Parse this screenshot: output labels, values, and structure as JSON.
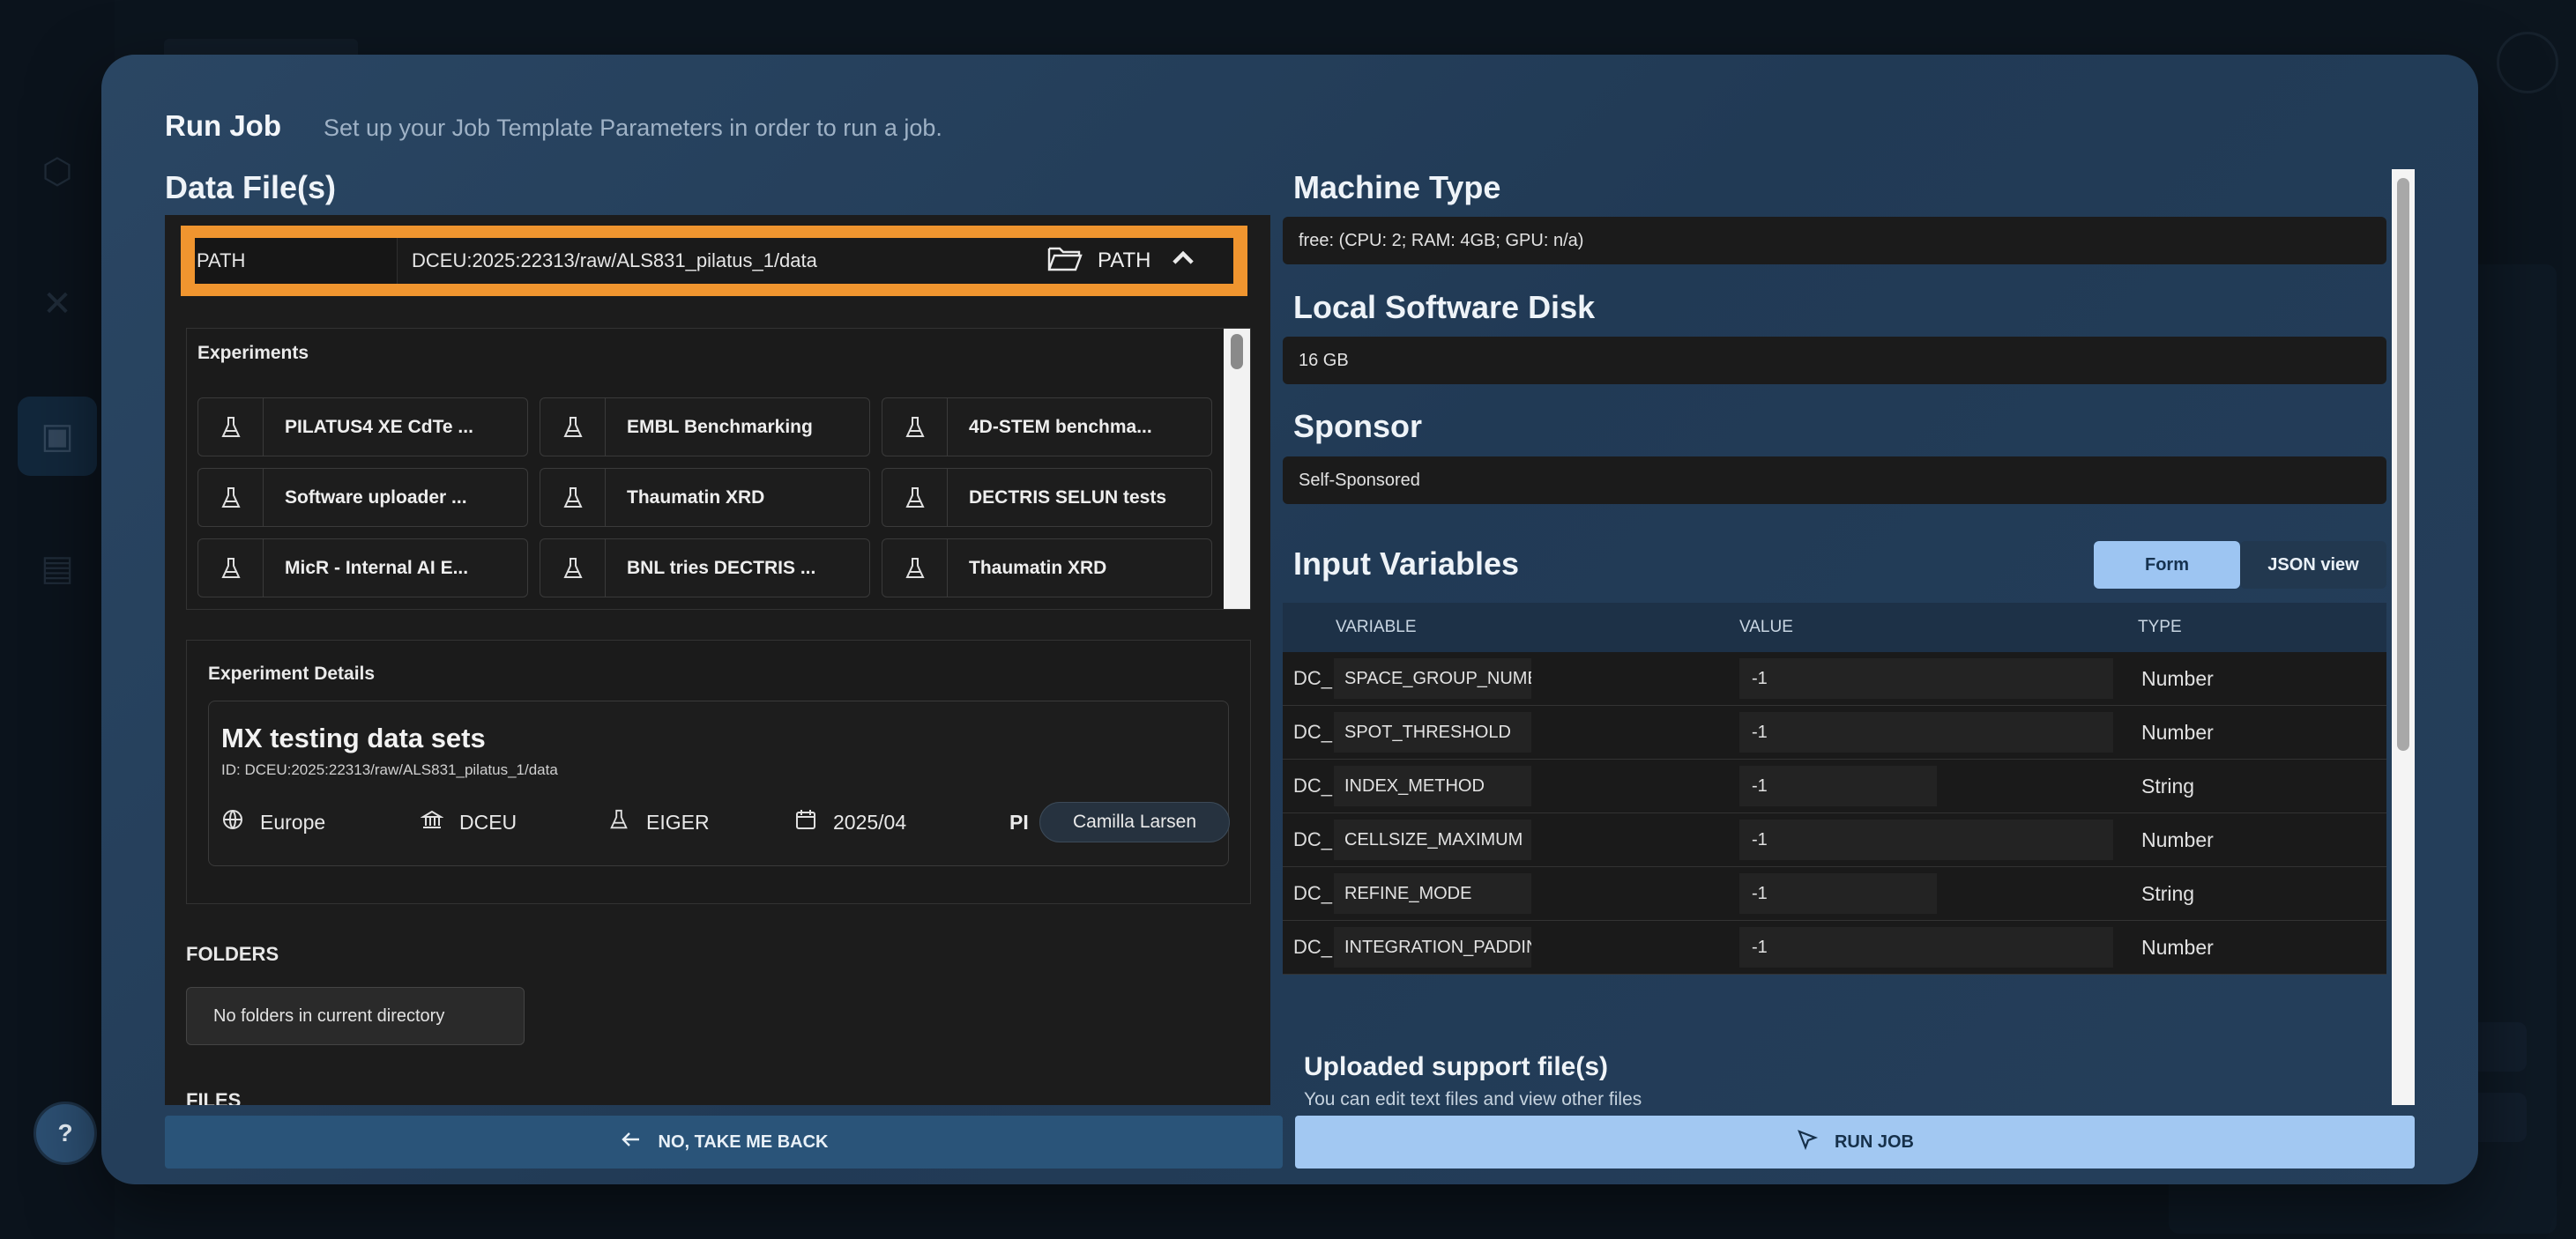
{
  "modal": {
    "title": "Run Job",
    "subtitle": "Set up your Job Template Parameters in order to run a job."
  },
  "data_files": {
    "title": "Data File(s)",
    "path_label": "PATH",
    "path_value": "DCEU:2025:22313/raw/ALS831_pilatus_1/data",
    "path_button": "PATH"
  },
  "experiments": {
    "title": "Experiments",
    "items": [
      {
        "name": "PILATUS4 XE CdTe ...",
        "icon": "flask-icon"
      },
      {
        "name": "EMBL Benchmarking",
        "icon": "flask-icon"
      },
      {
        "name": "4D-STEM benchma...",
        "icon": "flask-icon"
      },
      {
        "name": "Software uploader ...",
        "icon": "flask-icon"
      },
      {
        "name": "Thaumatin XRD",
        "icon": "flask-icon"
      },
      {
        "name": "DECTRIS SELUN tests",
        "icon": "flask-icon"
      },
      {
        "name": "MicR - Internal AI E...",
        "icon": "flask-icon"
      },
      {
        "name": "BNL tries DECTRIS ...",
        "icon": "flask-icon"
      },
      {
        "name": "Thaumatin XRD",
        "icon": "flask-icon"
      }
    ]
  },
  "experiment_details": {
    "title": "Experiment Details",
    "name": "MX testing data sets",
    "id": "ID: DCEU:2025:22313/raw/ALS831_pilatus_1/data",
    "region": "Europe",
    "institution": "DCEU",
    "instrument": "EIGER",
    "date": "2025/04",
    "pi_label": "PI",
    "pi_name": "Camilla Larsen"
  },
  "folders": {
    "title": "FOLDERS",
    "empty_text": "No folders in current directory"
  },
  "files": {
    "title": "FILES"
  },
  "machine_type": {
    "title": "Machine Type",
    "value": "free: (CPU: 2; RAM: 4GB; GPU: n/a)"
  },
  "local_software_disk": {
    "title": "Local Software Disk",
    "value": "16 GB"
  },
  "sponsor": {
    "title": "Sponsor",
    "value": "Self-Sponsored"
  },
  "input_variables": {
    "title": "Input Variables",
    "view_form": "Form",
    "view_json": "JSON view",
    "active_view": "Form",
    "columns": {
      "variable": "VARIABLE",
      "value": "VALUE",
      "type": "TYPE"
    },
    "rows": [
      {
        "prefix": "DC_",
        "name": "SPACE_GROUP_NUMBI",
        "value": "-1",
        "type": "Number"
      },
      {
        "prefix": "DC_",
        "name": "SPOT_THRESHOLD",
        "value": "-1",
        "type": "Number"
      },
      {
        "prefix": "DC_",
        "name": "INDEX_METHOD",
        "value": "-1",
        "type": "String"
      },
      {
        "prefix": "DC_",
        "name": "CELLSIZE_MAXIMUM",
        "value": "-1",
        "type": "Number"
      },
      {
        "prefix": "DC_",
        "name": "REFINE_MODE",
        "value": "-1",
        "type": "String"
      },
      {
        "prefix": "DC_",
        "name": "INTEGRATION_PADDIN",
        "value": "-1",
        "type": "Number"
      }
    ]
  },
  "uploaded_support": {
    "title": "Uploaded support file(s)",
    "subtitle": "You can edit text files and view other files"
  },
  "footer": {
    "back_label": "NO, TAKE ME BACK",
    "run_label": "RUN JOB"
  },
  "help": {
    "label": "?"
  },
  "colors": {
    "path_highlight": "#f0952f",
    "primary_button": "#a2c8f2",
    "secondary_button": "#2a5479"
  }
}
